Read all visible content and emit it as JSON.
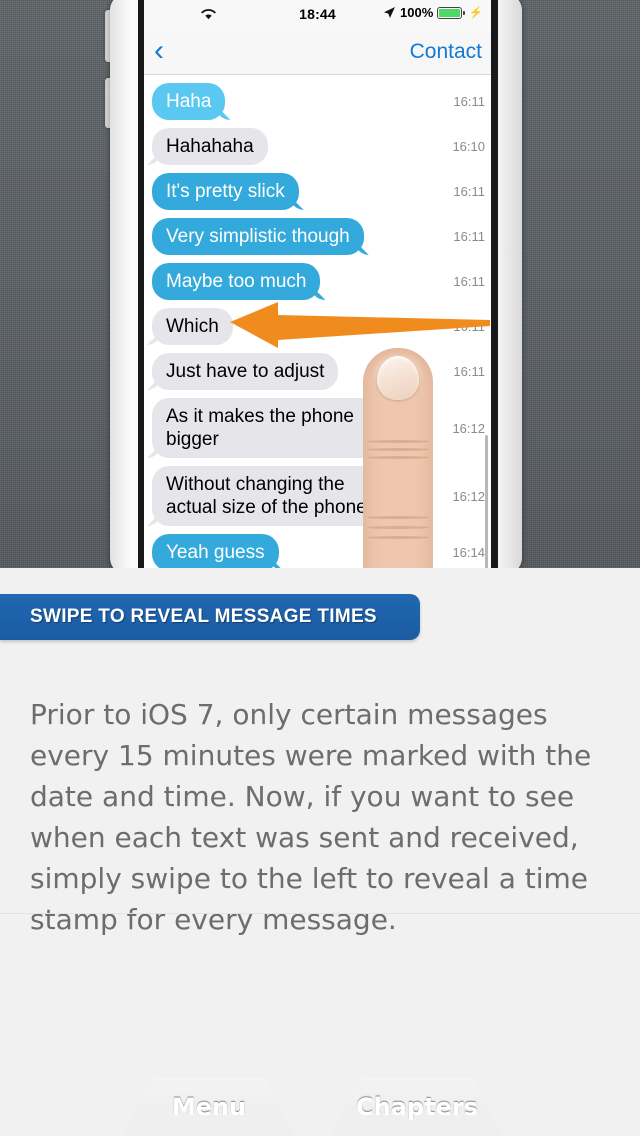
{
  "hero": {
    "status_bar": {
      "wifi_icon": "wifi-icon",
      "time": "18:44",
      "location_icon": "location-arrow-icon",
      "battery_percent": "100%",
      "battery_icon": "battery-icon",
      "charging_icon": "lightning-bolt-icon"
    },
    "nav_bar": {
      "back_icon": "chevron-left-icon",
      "title": "Contact"
    },
    "messages": [
      {
        "text": "Haha",
        "side": "out",
        "variant": "light",
        "time": "16:11"
      },
      {
        "text": "Hahahaha",
        "side": "in",
        "variant": "",
        "time": "16:10"
      },
      {
        "text": "It's pretty slick",
        "side": "out",
        "variant": "",
        "time": "16:11"
      },
      {
        "text": "Very simplistic though",
        "side": "out",
        "variant": "",
        "time": "16:11"
      },
      {
        "text": "Maybe too much",
        "side": "out",
        "variant": "",
        "time": "16:11"
      },
      {
        "text": "Which ",
        "side": "in",
        "variant": "",
        "time": "16:11"
      },
      {
        "text": "Just have to adjust",
        "side": "in",
        "variant": "",
        "time": "16:11"
      },
      {
        "text": "As it makes the phone bigger",
        "side": "in",
        "variant": "",
        "time": "16:12"
      },
      {
        "text": "Without changing the actual size of the phone",
        "side": "in",
        "variant": "",
        "time": "16:12"
      },
      {
        "text": "Yeah guess",
        "side": "out",
        "variant": "",
        "time": "16:14"
      }
    ],
    "annotation": {
      "arrow_icon": "orange-left-arrow-icon",
      "arrow_color": "#F08C1E"
    },
    "finger_icon": "finger-swipe-icon"
  },
  "content": {
    "banner_label": "SWIPE TO REVEAL MESSAGE TIMES",
    "banner_color": "#1b5ba3",
    "body": "Prior to iOS 7, only certain messages every 15 minutes were marked with the date and time. Now, if you want to see when each text was sent and received, simply swipe to the left to reveal a time stamp for every message."
  },
  "footer": {
    "menu_label": "Menu",
    "chapters_label": "Chapters"
  }
}
